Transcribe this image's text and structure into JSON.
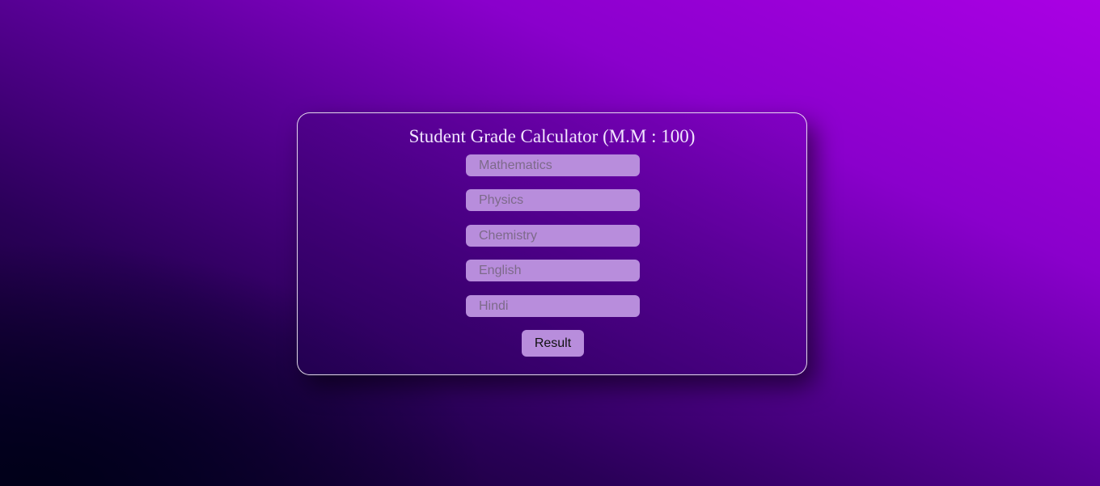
{
  "calculator": {
    "title": "Student Grade Calculator (M.M : 100)",
    "fields": [
      {
        "placeholder": "Mathematics",
        "value": ""
      },
      {
        "placeholder": "Physics",
        "value": ""
      },
      {
        "placeholder": "Chemistry",
        "value": ""
      },
      {
        "placeholder": "English",
        "value": ""
      },
      {
        "placeholder": "Hindi",
        "value": ""
      }
    ],
    "result_label": "Result"
  }
}
